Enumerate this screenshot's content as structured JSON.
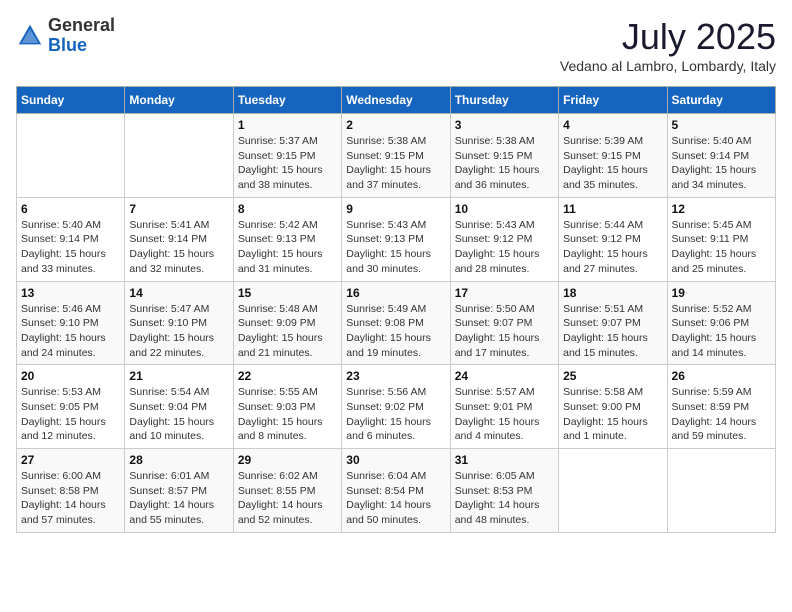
{
  "header": {
    "logo_general": "General",
    "logo_blue": "Blue",
    "month_title": "July 2025",
    "location": "Vedano al Lambro, Lombardy, Italy"
  },
  "weekdays": [
    "Sunday",
    "Monday",
    "Tuesday",
    "Wednesday",
    "Thursday",
    "Friday",
    "Saturday"
  ],
  "weeks": [
    [
      {
        "day": "",
        "info": ""
      },
      {
        "day": "",
        "info": ""
      },
      {
        "day": "1",
        "info": "Sunrise: 5:37 AM\nSunset: 9:15 PM\nDaylight: 15 hours\nand 38 minutes."
      },
      {
        "day": "2",
        "info": "Sunrise: 5:38 AM\nSunset: 9:15 PM\nDaylight: 15 hours\nand 37 minutes."
      },
      {
        "day": "3",
        "info": "Sunrise: 5:38 AM\nSunset: 9:15 PM\nDaylight: 15 hours\nand 36 minutes."
      },
      {
        "day": "4",
        "info": "Sunrise: 5:39 AM\nSunset: 9:15 PM\nDaylight: 15 hours\nand 35 minutes."
      },
      {
        "day": "5",
        "info": "Sunrise: 5:40 AM\nSunset: 9:14 PM\nDaylight: 15 hours\nand 34 minutes."
      }
    ],
    [
      {
        "day": "6",
        "info": "Sunrise: 5:40 AM\nSunset: 9:14 PM\nDaylight: 15 hours\nand 33 minutes."
      },
      {
        "day": "7",
        "info": "Sunrise: 5:41 AM\nSunset: 9:14 PM\nDaylight: 15 hours\nand 32 minutes."
      },
      {
        "day": "8",
        "info": "Sunrise: 5:42 AM\nSunset: 9:13 PM\nDaylight: 15 hours\nand 31 minutes."
      },
      {
        "day": "9",
        "info": "Sunrise: 5:43 AM\nSunset: 9:13 PM\nDaylight: 15 hours\nand 30 minutes."
      },
      {
        "day": "10",
        "info": "Sunrise: 5:43 AM\nSunset: 9:12 PM\nDaylight: 15 hours\nand 28 minutes."
      },
      {
        "day": "11",
        "info": "Sunrise: 5:44 AM\nSunset: 9:12 PM\nDaylight: 15 hours\nand 27 minutes."
      },
      {
        "day": "12",
        "info": "Sunrise: 5:45 AM\nSunset: 9:11 PM\nDaylight: 15 hours\nand 25 minutes."
      }
    ],
    [
      {
        "day": "13",
        "info": "Sunrise: 5:46 AM\nSunset: 9:10 PM\nDaylight: 15 hours\nand 24 minutes."
      },
      {
        "day": "14",
        "info": "Sunrise: 5:47 AM\nSunset: 9:10 PM\nDaylight: 15 hours\nand 22 minutes."
      },
      {
        "day": "15",
        "info": "Sunrise: 5:48 AM\nSunset: 9:09 PM\nDaylight: 15 hours\nand 21 minutes."
      },
      {
        "day": "16",
        "info": "Sunrise: 5:49 AM\nSunset: 9:08 PM\nDaylight: 15 hours\nand 19 minutes."
      },
      {
        "day": "17",
        "info": "Sunrise: 5:50 AM\nSunset: 9:07 PM\nDaylight: 15 hours\nand 17 minutes."
      },
      {
        "day": "18",
        "info": "Sunrise: 5:51 AM\nSunset: 9:07 PM\nDaylight: 15 hours\nand 15 minutes."
      },
      {
        "day": "19",
        "info": "Sunrise: 5:52 AM\nSunset: 9:06 PM\nDaylight: 15 hours\nand 14 minutes."
      }
    ],
    [
      {
        "day": "20",
        "info": "Sunrise: 5:53 AM\nSunset: 9:05 PM\nDaylight: 15 hours\nand 12 minutes."
      },
      {
        "day": "21",
        "info": "Sunrise: 5:54 AM\nSunset: 9:04 PM\nDaylight: 15 hours\nand 10 minutes."
      },
      {
        "day": "22",
        "info": "Sunrise: 5:55 AM\nSunset: 9:03 PM\nDaylight: 15 hours\nand 8 minutes."
      },
      {
        "day": "23",
        "info": "Sunrise: 5:56 AM\nSunset: 9:02 PM\nDaylight: 15 hours\nand 6 minutes."
      },
      {
        "day": "24",
        "info": "Sunrise: 5:57 AM\nSunset: 9:01 PM\nDaylight: 15 hours\nand 4 minutes."
      },
      {
        "day": "25",
        "info": "Sunrise: 5:58 AM\nSunset: 9:00 PM\nDaylight: 15 hours\nand 1 minute."
      },
      {
        "day": "26",
        "info": "Sunrise: 5:59 AM\nSunset: 8:59 PM\nDaylight: 14 hours\nand 59 minutes."
      }
    ],
    [
      {
        "day": "27",
        "info": "Sunrise: 6:00 AM\nSunset: 8:58 PM\nDaylight: 14 hours\nand 57 minutes."
      },
      {
        "day": "28",
        "info": "Sunrise: 6:01 AM\nSunset: 8:57 PM\nDaylight: 14 hours\nand 55 minutes."
      },
      {
        "day": "29",
        "info": "Sunrise: 6:02 AM\nSunset: 8:55 PM\nDaylight: 14 hours\nand 52 minutes."
      },
      {
        "day": "30",
        "info": "Sunrise: 6:04 AM\nSunset: 8:54 PM\nDaylight: 14 hours\nand 50 minutes."
      },
      {
        "day": "31",
        "info": "Sunrise: 6:05 AM\nSunset: 8:53 PM\nDaylight: 14 hours\nand 48 minutes."
      },
      {
        "day": "",
        "info": ""
      },
      {
        "day": "",
        "info": ""
      }
    ]
  ]
}
